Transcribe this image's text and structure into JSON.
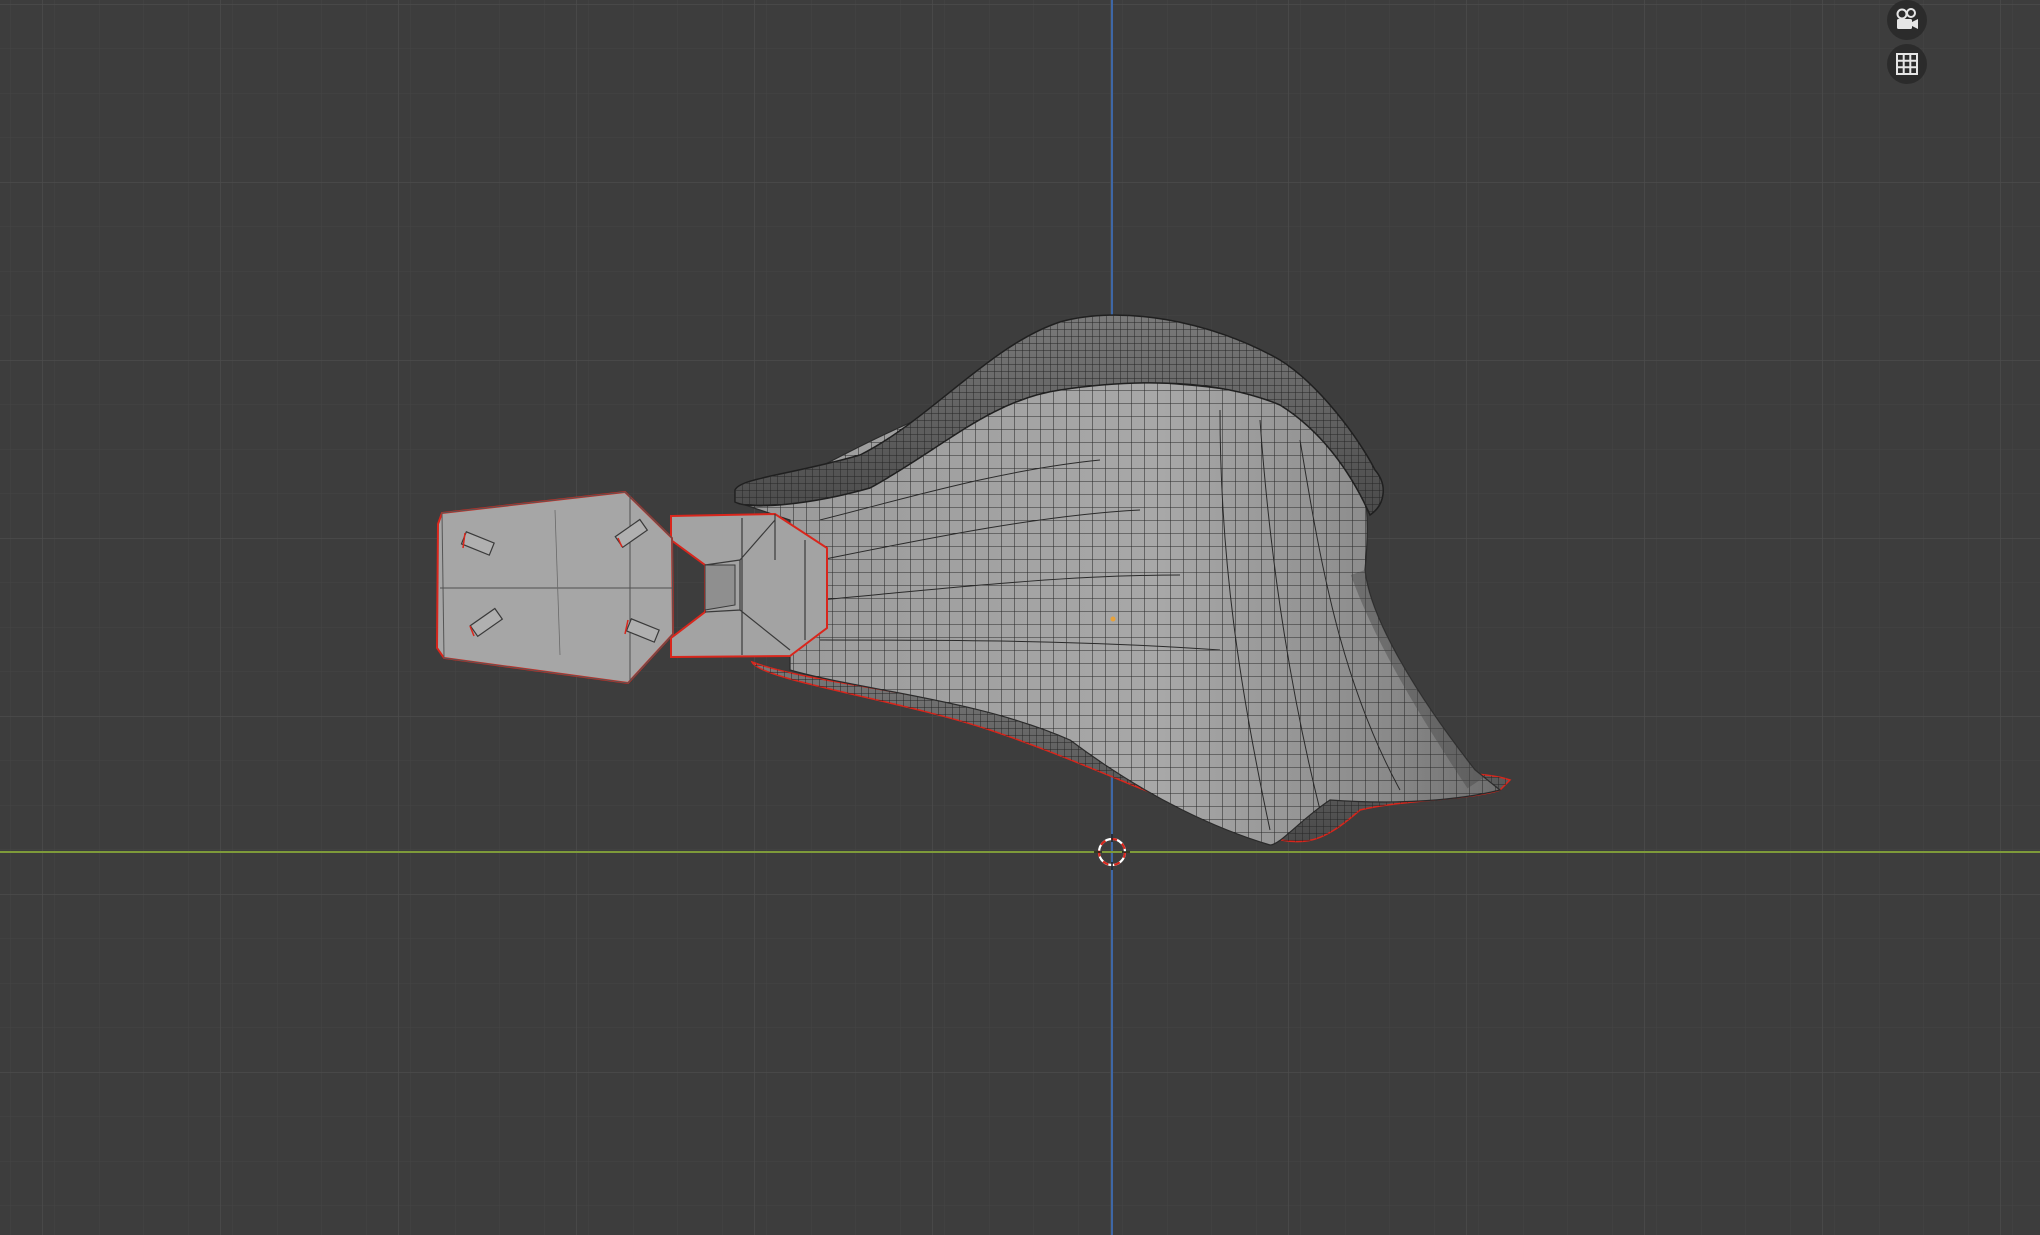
{
  "viewport": {
    "background_color": "#3d3d3d",
    "grid_minor_color": "#454545",
    "grid_major_color": "#4d4d4d",
    "x_axis_color": "#7e9a3a",
    "z_axis_color": "#3e67a6",
    "selection_outline_color": "#d9261c",
    "mesh_color": "#9e9e9e",
    "wire_color": "#2a2a2a"
  },
  "nav_gizmo": {
    "camera_button": {
      "icon": "camera-icon"
    },
    "ortho_toggle_button": {
      "icon": "grid-icon"
    }
  },
  "scene": {
    "objects": [
      {
        "name": "clip-mesh",
        "selected": true
      },
      {
        "name": "connector-mesh",
        "selected": true
      },
      {
        "name": "flared-surface-mesh",
        "selected": true
      }
    ],
    "cursor": {
      "icon": "3d-cursor-icon"
    }
  }
}
